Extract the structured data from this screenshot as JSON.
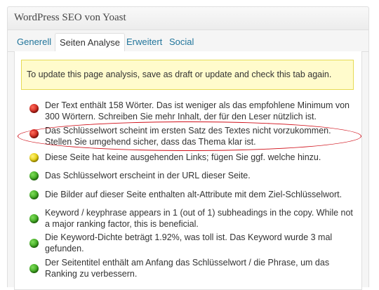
{
  "metabox": {
    "title": "WordPress SEO von Yoast"
  },
  "tabs": [
    {
      "label": "Generell",
      "active": false
    },
    {
      "label": "Seiten Analyse",
      "active": true
    },
    {
      "label": "Erweitert",
      "active": false
    },
    {
      "label": "Social",
      "active": false
    }
  ],
  "notice": {
    "text": "To update this page analysis, save as draft or update and check this tab again."
  },
  "results": [
    {
      "status": "red",
      "text": "Der Text enthält 158 Wörter. Das ist weniger als das empfohlene Minimum von 300 Wörtern. Schreiben Sie mehr Inhalt, der für den Leser nützlich ist."
    },
    {
      "status": "red",
      "text": "Das Schlüsselwort scheint im ersten Satz des Textes nicht vorzukommen. Stellen Sie umgehend sicher, dass das Thema klar ist."
    },
    {
      "status": "yellow",
      "text": "Diese Seite hat keine ausgehenden Links; fügen Sie ggf. welche hinzu."
    },
    {
      "status": "green",
      "text": "Das Schlüsselwort erscheint in der URL dieser Seite."
    },
    {
      "status": "green",
      "text": "Die Bilder auf dieser Seite enthalten alt-Attribute mit dem Ziel-Schlüsselwort."
    },
    {
      "status": "green",
      "text": "Keyword / keyphrase appears in 1 (out of 1) subheadings in the copy. While not a major ranking factor, this is beneficial."
    },
    {
      "status": "green",
      "text": "Die Keyword-Dichte beträgt 1.92%, was toll ist. Das Keyword wurde 3 mal gefunden."
    },
    {
      "status": "green",
      "text": "Der Seitentitel enthält am Anfang das Schlüsselwort / die Phrase, um das Ranking zu verbessern."
    }
  ],
  "colors": {
    "red": "#c8231a",
    "yellow": "#e0c800",
    "green": "#3aa51c",
    "link": "#21759b",
    "annotation": "#d0101a"
  }
}
